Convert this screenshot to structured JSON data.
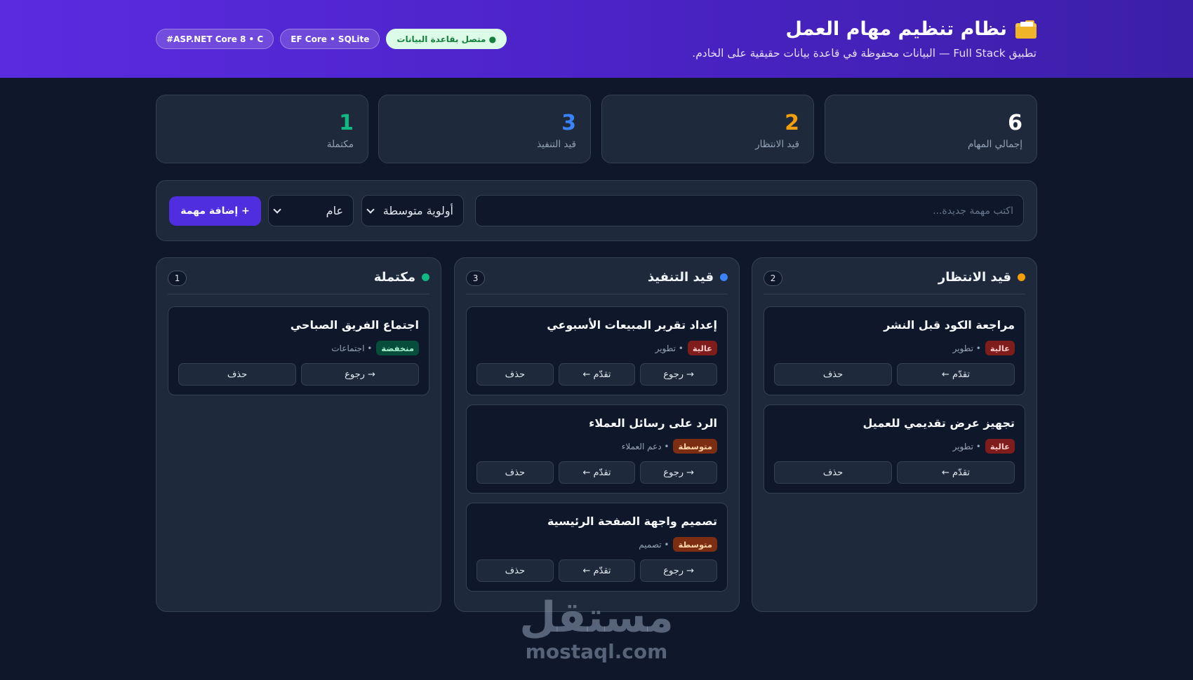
{
  "header": {
    "title": "نظام تنظيم مهام العمل",
    "title_icon": "folder-icon",
    "subtitle": "تطبيق Full Stack — البيانات محفوظة في قاعدة بيانات حقيقية على الخادم.",
    "badges": [
      "ASP.NET Core 8 • C#",
      "EF Core • SQLite",
      "● متصل بقاعدة البيانات"
    ]
  },
  "colors": {
    "brand": "#4f2ee0",
    "pending": "#f59e0b",
    "in_progress": "#3b82f6",
    "done": "#10b981",
    "total": "#ffffff"
  },
  "stats": [
    {
      "value": "6",
      "label": "إجمالي المهام"
    },
    {
      "value": "2",
      "label": "قيد الانتظار"
    },
    {
      "value": "3",
      "label": "قيد التنفيذ"
    },
    {
      "value": "1",
      "label": "مكتملة"
    }
  ],
  "form": {
    "input_placeholder": "اكتب مهمة جديدة...",
    "priority_value": "أولوية متوسطة",
    "category_value": "عام",
    "add_label": "+ إضافة مهمة"
  },
  "columns": [
    {
      "title": "قيد الانتظار",
      "count": "2",
      "cards": [
        {
          "title": "مراجعة الكود قبل النشر",
          "priority": "عالية",
          "category": "• تطوير",
          "actions": [
            "تقدّم ←",
            "حذف"
          ]
        },
        {
          "title": "تجهيز عرض تقديمي للعميل",
          "priority": "عالية",
          "category": "• تطوير",
          "actions": [
            "تقدّم ←",
            "حذف"
          ]
        }
      ]
    },
    {
      "title": "قيد التنفيذ",
      "count": "3",
      "cards": [
        {
          "title": "إعداد تقرير المبيعات الأسبوعي",
          "priority": "عالية",
          "category": "• تطوير",
          "actions": [
            "→ رجوع",
            "تقدّم ←",
            "حذف"
          ]
        },
        {
          "title": "الرد على رسائل العملاء",
          "priority": "متوسطة",
          "category": "• دعم العملاء",
          "actions": [
            "→ رجوع",
            "تقدّم ←",
            "حذف"
          ]
        },
        {
          "title": "تصميم واجهة الصفحة الرئيسية",
          "priority": "متوسطة",
          "category": "• تصميم",
          "actions": [
            "→ رجوع",
            "تقدّم ←",
            "حذف"
          ]
        }
      ]
    },
    {
      "title": "مكتملة",
      "count": "1",
      "cards": [
        {
          "title": "اجتماع الفريق الصباحي",
          "priority": "منخفضة",
          "category": "• اجتماعات",
          "actions": [
            "→ رجوع",
            "حذف"
          ]
        }
      ]
    }
  ],
  "watermark": {
    "arabic": "مستقل",
    "latin": "mostaql.com"
  }
}
